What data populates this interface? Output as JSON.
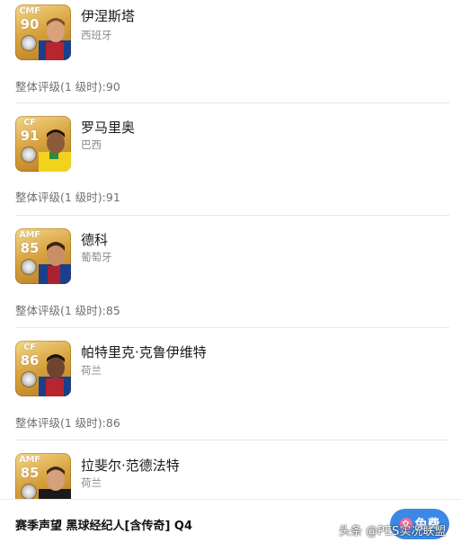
{
  "players": [
    {
      "position": "CMF",
      "overall": "90",
      "name": "伊涅斯塔",
      "nation": "西班牙",
      "rating": "整体评级(1 级时):90",
      "icons": {
        "badge": "coin-badge-icon",
        "photo": "player-photo"
      }
    },
    {
      "position": "CF",
      "overall": "91",
      "name": "罗马里奥",
      "nation": "巴西",
      "rating": "整体评级(1 级时):91",
      "icons": {
        "badge": "coin-badge-icon",
        "photo": "player-photo"
      }
    },
    {
      "position": "AMF",
      "overall": "85",
      "name": "德科",
      "nation": "葡萄牙",
      "rating": "整体评级(1 级时):85",
      "icons": {
        "badge": "coin-badge-icon",
        "photo": "player-photo"
      }
    },
    {
      "position": "CF",
      "overall": "86",
      "name": "帕特里克·克鲁伊维特",
      "nation": "荷兰",
      "rating": "整体评级(1 级时):86",
      "icons": {
        "badge": "coin-badge-icon",
        "photo": "player-photo"
      }
    },
    {
      "position": "AMF",
      "overall": "85",
      "name": "拉斐尔·范德法特",
      "nation": "荷兰",
      "rating": "",
      "icons": {
        "badge": "coin-badge-icon",
        "photo": "player-photo"
      }
    }
  ],
  "bottom": {
    "title": "赛季声望 黑球经纪人[含传奇] Q4",
    "free_label": "免费",
    "gift_icon": "gift-icon"
  },
  "watermark": "头条 @PES实况联盟",
  "colors": {
    "card_gold": "#d9a441",
    "button_blue": "#3b88e6",
    "gift_pink": "#f06aa0"
  }
}
